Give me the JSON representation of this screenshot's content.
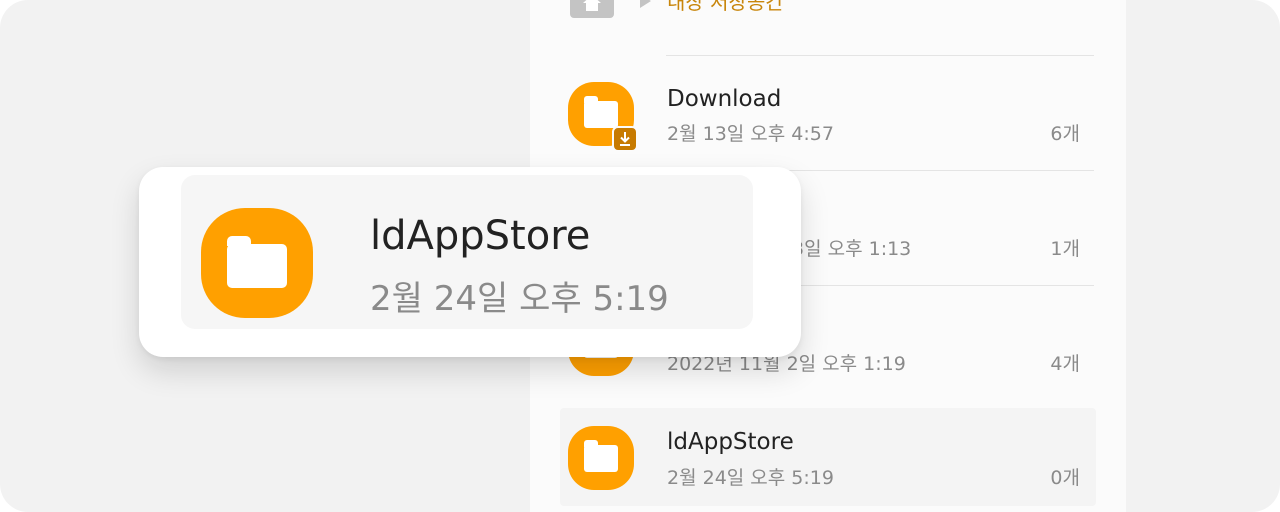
{
  "breadcrumb": {
    "label": "내장 저장공간"
  },
  "rows": [
    {
      "name": "Download",
      "date": "2월 13일 오후 4:57",
      "count": "6개"
    },
    {
      "name": "",
      "date": "3일 오후 1:13",
      "count": "1개"
    },
    {
      "name": "",
      "date": "2022년 11월 2일 오후 1:19",
      "count": "4개"
    },
    {
      "name": "ldAppStore",
      "date": "2월 24일 오후 5:19",
      "count": "0개"
    }
  ],
  "card": {
    "name": "ldAppStore",
    "date": "2월 24일 오후 5:19"
  },
  "colors": {
    "folder": "#ffa000",
    "badge": "#c77a00",
    "crumb": "#c8860c"
  },
  "icons": {
    "home": "home-icon",
    "folder": "folder-icon",
    "download_badge": "download-icon"
  }
}
